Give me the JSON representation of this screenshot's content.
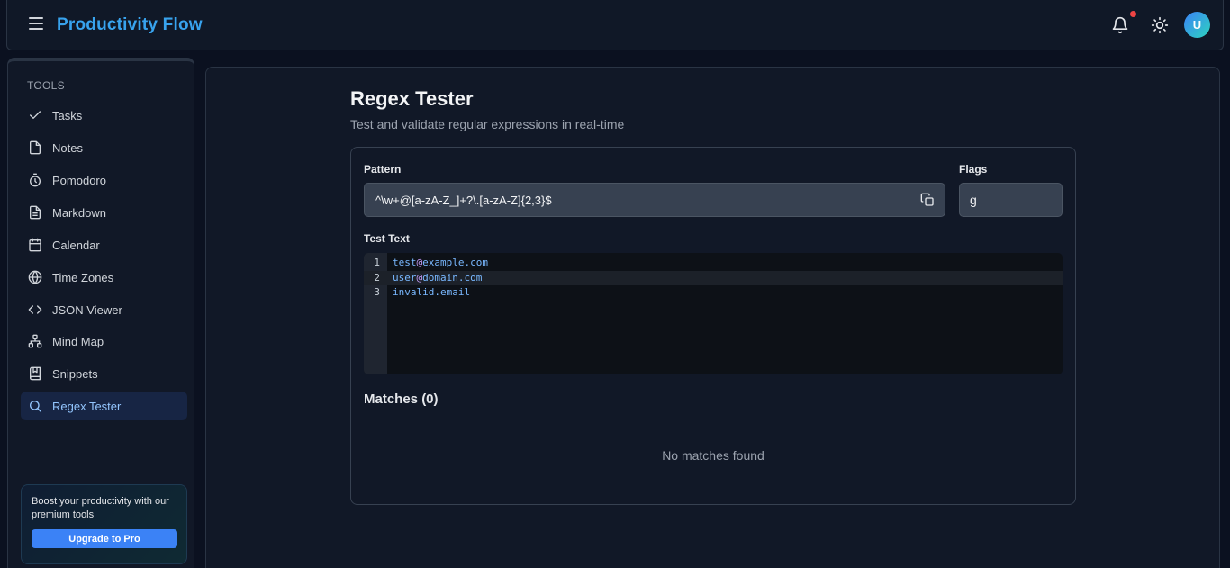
{
  "header": {
    "app_title": "Productivity Flow",
    "avatar_initial": "U"
  },
  "sidebar": {
    "section_label": "TOOLS",
    "items": [
      {
        "label": "Tasks",
        "icon": "check-icon"
      },
      {
        "label": "Notes",
        "icon": "file-icon"
      },
      {
        "label": "Pomodoro",
        "icon": "timer-icon"
      },
      {
        "label": "Markdown",
        "icon": "file-text-icon"
      },
      {
        "label": "Calendar",
        "icon": "calendar-icon"
      },
      {
        "label": "Time Zones",
        "icon": "globe-icon"
      },
      {
        "label": "JSON Viewer",
        "icon": "code-icon"
      },
      {
        "label": "Mind Map",
        "icon": "network-icon"
      },
      {
        "label": "Snippets",
        "icon": "book-icon"
      },
      {
        "label": "Regex Tester",
        "icon": "search-icon",
        "active": true
      }
    ],
    "promo": {
      "text": "Boost your productivity with our premium tools",
      "button": "Upgrade to Pro"
    }
  },
  "main": {
    "title": "Regex Tester",
    "subtitle": "Test and validate regular expressions in real-time",
    "pattern_label": "Pattern",
    "pattern_value": "^\\w+@[a-zA-Z_]+?\\.[a-zA-Z]{2,3}$",
    "flags_label": "Flags",
    "flags_value": "g",
    "test_text_label": "Test Text",
    "test_lines": [
      {
        "num": "1",
        "before": "test",
        "at": "@",
        "after": "example.com"
      },
      {
        "num": "2",
        "before": "user",
        "at": "@",
        "after": "domain.com"
      },
      {
        "num": "3",
        "before": "invalid.email",
        "at": "",
        "after": ""
      }
    ],
    "matches_title": "Matches (0)",
    "no_matches": "No matches found"
  },
  "colors": {
    "accent": "#3b82f6",
    "title_blue": "#38a3ee",
    "background": "#0b1120",
    "panel": "#111827",
    "notification": "#ef4444"
  }
}
